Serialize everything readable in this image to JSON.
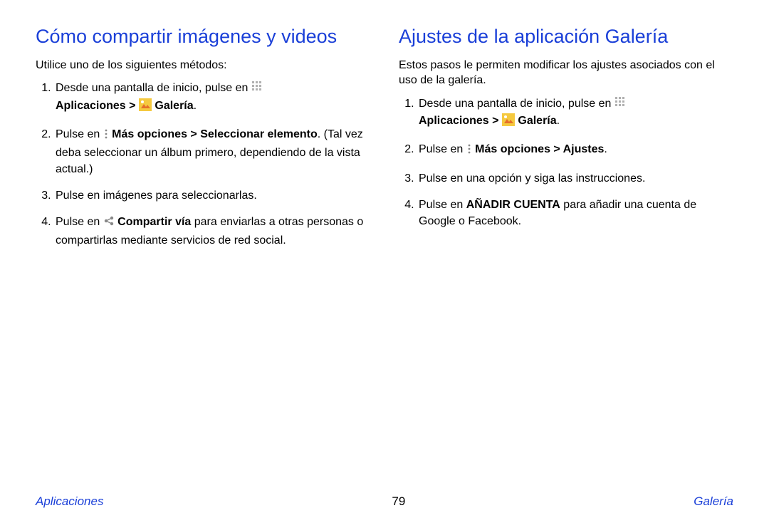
{
  "left": {
    "heading": "Cómo compartir imágenes y videos",
    "intro": "Utilice uno de los siguientes métodos:",
    "step1_a": "Desde una pantalla de inicio, pulse en ",
    "step1_b": "Aplicaciones > ",
    "step1_c": " Galería",
    "step1_d": ".",
    "step2_a": "Pulse en ",
    "step2_b": " Más opciones > Seleccionar elemento",
    "step2_c": ". (Tal vez deba seleccionar un álbum primero, dependiendo de la vista actual.)",
    "step3": "Pulse en imágenes para seleccionarlas.",
    "step4_a": "Pulse en ",
    "step4_b": " Compartir vía",
    "step4_c": " para enviarlas a otras personas o compartirlas mediante servicios de red social."
  },
  "right": {
    "heading": "Ajustes de la aplicación Galería",
    "intro": "Estos pasos le permiten modificar los ajustes asociados con el uso de la galería.",
    "step1_a": "Desde una pantalla de inicio, pulse en ",
    "step1_b": "Aplicaciones > ",
    "step1_c": " Galería",
    "step1_d": ".",
    "step2_a": "Pulse en ",
    "step2_b": " Más opciones > Ajustes",
    "step2_c": ".",
    "step3": "Pulse en una opción y siga las instrucciones.",
    "step4_a": "Pulse en ",
    "step4_b": "AÑADIR CUENTA",
    "step4_c": " para añadir una cuenta de Google o Facebook."
  },
  "footer": {
    "left": "Aplicaciones",
    "center": "79",
    "right": "Galería"
  }
}
